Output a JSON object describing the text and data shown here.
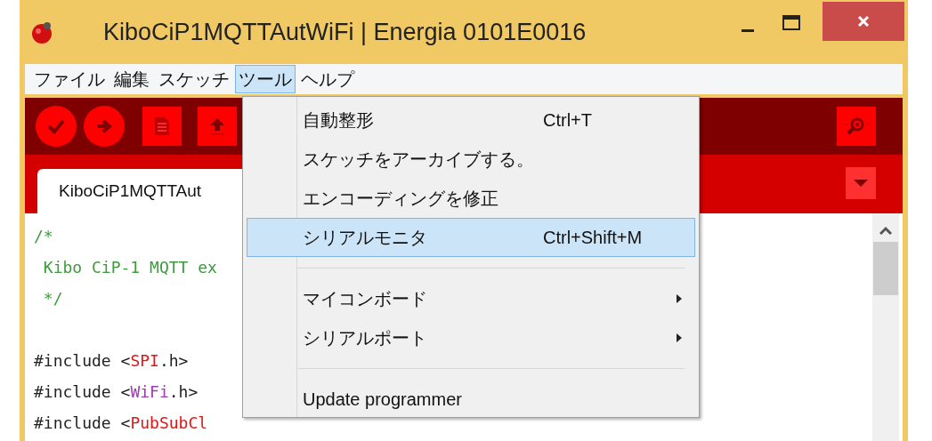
{
  "window": {
    "title": "KiboCiP1MQTTAutWiFi | Energia 0101E0016"
  },
  "menubar": [
    {
      "label": "ファイル",
      "selected": false
    },
    {
      "label": "編集",
      "selected": false
    },
    {
      "label": "スケッチ",
      "selected": false
    },
    {
      "label": "ツール",
      "selected": true
    },
    {
      "label": "ヘルプ",
      "selected": false
    }
  ],
  "tabs": [
    {
      "label": "KiboCiP1MQTTAut",
      "selected": true
    }
  ],
  "code_lines": [
    {
      "kind": "code",
      "segments": [
        {
          "kind": "comment",
          "text": "/*"
        }
      ]
    },
    {
      "kind": "code",
      "segments": [
        {
          "kind": "comment",
          "text": " Kibo CiP-1 MQTT ex"
        }
      ]
    },
    {
      "kind": "code",
      "segments": [
        {
          "kind": "comment",
          "text": " */"
        }
      ]
    },
    {
      "kind": "blank"
    },
    {
      "kind": "code",
      "segments": [
        {
          "kind": "plain",
          "text": "#include <"
        },
        {
          "kind": "library",
          "text": "SPI"
        },
        {
          "kind": "plain",
          "text": ".h>"
        }
      ]
    },
    {
      "kind": "code",
      "segments": [
        {
          "kind": "plain",
          "text": "#include <"
        },
        {
          "kind": "class",
          "text": "WiFi"
        },
        {
          "kind": "plain",
          "text": ".h>"
        }
      ]
    },
    {
      "kind": "code",
      "segments": [
        {
          "kind": "plain",
          "text": "#include <"
        },
        {
          "kind": "library",
          "text": "PubSubCl"
        }
      ]
    }
  ],
  "tools_menu": [
    {
      "kind": "item",
      "label": "自動整形",
      "shortcut": "Ctrl+T",
      "selected": false
    },
    {
      "kind": "item",
      "label": "スケッチをアーカイブする。",
      "selected": false
    },
    {
      "kind": "item",
      "label": "エンコーディングを修正",
      "selected": false
    },
    {
      "kind": "item",
      "label": "シリアルモニタ",
      "shortcut": "Ctrl+Shift+M",
      "selected": true
    },
    {
      "kind": "separator"
    },
    {
      "kind": "submenu",
      "label": "マイコンボード",
      "selected": false
    },
    {
      "kind": "submenu",
      "label": "シリアルポート",
      "selected": false
    },
    {
      "kind": "separator"
    },
    {
      "kind": "item",
      "label": "Update programmer",
      "selected": false
    }
  ]
}
